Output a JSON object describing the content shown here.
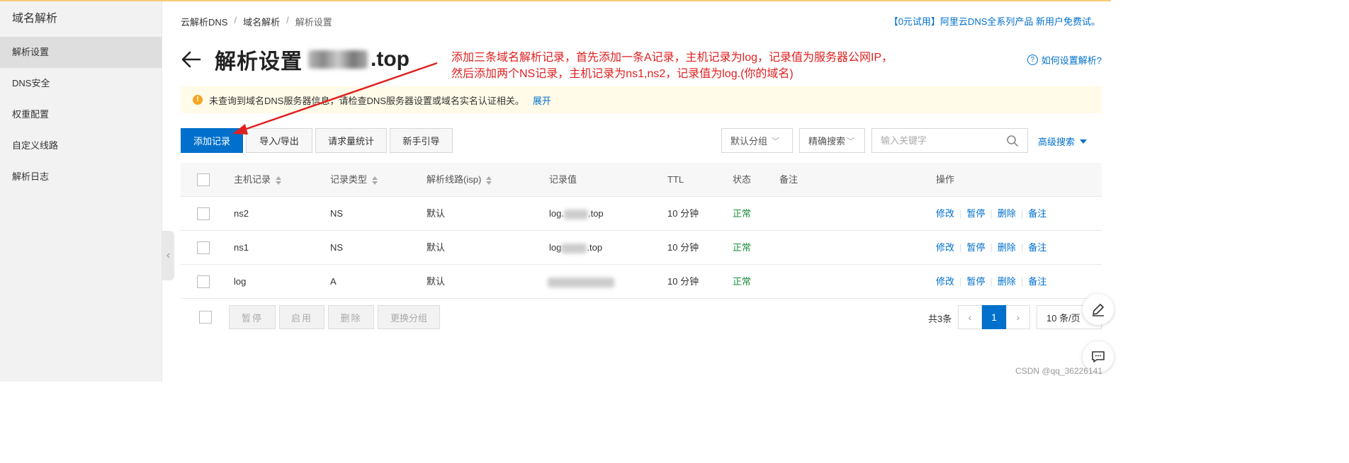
{
  "sidebar": {
    "title": "域名解析",
    "items": [
      {
        "label": "解析设置",
        "active": true
      },
      {
        "label": "DNS安全"
      },
      {
        "label": "权重配置"
      },
      {
        "label": "自定义线路"
      },
      {
        "label": "解析日志"
      }
    ]
  },
  "breadcrumb": [
    "云解析DNS",
    "域名解析",
    "解析设置"
  ],
  "promo_link": "【0元试用】阿里云DNS全系列产品 新用户免费试。",
  "header": {
    "title": "解析设置",
    "domain_suffix": ".top",
    "help_link": "如何设置解析?"
  },
  "annotation": {
    "line1": "添加三条域名解析记录，首先添加一条A记录，主机记录为log，记录值为服务器公网IP，",
    "line2": "然后添加两个NS记录，主机记录为ns1,ns2，记录值为log.(你的域名)"
  },
  "notice": {
    "text": "未查询到域名DNS服务器信息，请检查DNS服务器设置或域名实名认证相关。",
    "expand": "展开"
  },
  "toolbar": {
    "add_record": "添加记录",
    "import_export": "导入/导出",
    "request_stats": "请求量统计",
    "guide": "新手引导",
    "group_select": "默认分组",
    "search_mode": "精确搜索",
    "search_placeholder": "输入关键字",
    "advanced_search": "高级搜索"
  },
  "table": {
    "columns": [
      "主机记录",
      "记录类型",
      "解析线路(isp)",
      "记录值",
      "TTL",
      "状态",
      "备注",
      "操作"
    ],
    "rows": [
      {
        "host": "ns2",
        "type": "NS",
        "line": "默认",
        "value_prefix": "log.",
        "value_suffix": ".top",
        "ttl": "10 分钟",
        "status": "正常",
        "remark": ""
      },
      {
        "host": "ns1",
        "type": "NS",
        "line": "默认",
        "value_prefix": "log",
        "value_suffix": ".top",
        "ttl": "10 分钟",
        "status": "正常",
        "remark": ""
      },
      {
        "host": "log",
        "type": "A",
        "line": "默认",
        "value_prefix": "",
        "value_suffix": "",
        "ttl": "10 分钟",
        "status": "正常",
        "remark": ""
      }
    ],
    "actions": [
      "修改",
      "暂停",
      "删除",
      "备注"
    ]
  },
  "footer": {
    "pause": "暂停",
    "enable": "启用",
    "delete": "删除",
    "change_group": "更换分组",
    "total": "共3条",
    "current_page": "1",
    "page_size": "10 条/页"
  },
  "watermark": "CSDN @qq_36226141",
  "colors": {
    "primary": "#0070cc",
    "annotation": "#e02020",
    "status_normal": "#1e8e3e",
    "notice_bg": "#fffbe8"
  }
}
